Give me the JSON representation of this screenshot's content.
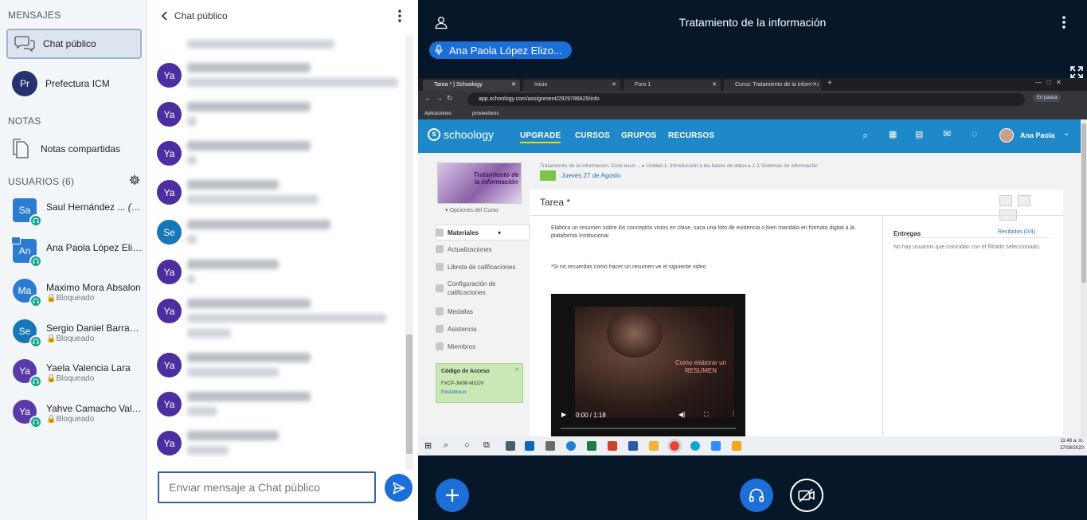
{
  "sidebar": {
    "messages_title": "MENSAJES",
    "chats": [
      {
        "label": "Chat público",
        "active": true
      },
      {
        "label": "Prefectura ICM",
        "initials": "Pr"
      }
    ],
    "notes_title": "NOTAS",
    "notes": {
      "label": "Notas compartidas"
    },
    "users_title": "USUARIOS (6)",
    "users": [
      {
        "initials": "Sa",
        "name": "Saul Hernández ...",
        "suffix": "(Tu)",
        "status": "",
        "color": "#2b7bd1",
        "shape": "square"
      },
      {
        "initials": "An",
        "name": "Ana Paola López Elizondo",
        "status": "",
        "color": "#2b7bd1",
        "shape": "square"
      },
      {
        "initials": "Ma",
        "name": "Maximo Mora Absalon",
        "status": "Bloqueado",
        "color": "#2b7bd1",
        "shape": "circle"
      },
      {
        "initials": "Se",
        "name": "Sergio Daniel Barranco López",
        "status": "Bloqueado",
        "color": "#1676b8",
        "shape": "circle"
      },
      {
        "initials": "Ya",
        "name": "Yaela Valencia Lara",
        "status": "Bloqueado",
        "color": "#5a3aa8",
        "shape": "circle"
      },
      {
        "initials": "Ya",
        "name": "Yahve Camacho Valencia",
        "status": "Bloqueado",
        "color": "#5a3aa8",
        "shape": "circle"
      }
    ]
  },
  "chat": {
    "title": "Chat público",
    "input_placeholder": "Enviar mensaje a Chat público",
    "messages": [
      {
        "initials": "Ya",
        "color": "#4b2fa0"
      },
      {
        "initials": "Ya",
        "color": "#4b2fa0"
      },
      {
        "initials": "Ya",
        "color": "#4b2fa0"
      },
      {
        "initials": "Ya",
        "color": "#4b2fa0"
      },
      {
        "initials": "Se",
        "color": "#1676b8"
      },
      {
        "initials": "Ya",
        "color": "#4b2fa0"
      },
      {
        "initials": "Ya",
        "color": "#4b2fa0"
      },
      {
        "initials": "Ya",
        "color": "#4b2fa0"
      },
      {
        "initials": "Ya",
        "color": "#4b2fa0"
      },
      {
        "initials": "Ya",
        "color": "#4b2fa0"
      }
    ]
  },
  "presentation": {
    "title": "Tratamiento de la información",
    "talker": "Ana Paola López Elizo...",
    "browser": {
      "tabs": [
        "Tarea * | Schoology",
        "Inicio",
        "Foro 1",
        "Curso: Tratamiento de la informac"
      ],
      "url": "app.schoology.com/assignment/2929786625/info",
      "paused": "En pausa",
      "bookmarks": [
        "Aplicaciones",
        "proveedores"
      ]
    },
    "schoology": {
      "logo": "schoology",
      "nav": [
        "UPGRADE",
        "CURSOS",
        "GRUPOS",
        "RECURSOS"
      ],
      "user": "Ana Paola",
      "course_image_text": "Tratamiento de la información",
      "course_options": "Opciones del Curso",
      "menu": [
        "Materiales",
        "Actualizaciones",
        "Libreta de calificaciones",
        "Configuración de calificaciones",
        "Medallas",
        "Asistencia",
        "Miembros"
      ],
      "access_code_title": "Código de Acceso",
      "access_code": "FXCP-JW98-M3JJV",
      "access_reset": "Restablecer",
      "breadcrumb": "Tratamiento de la información: Ciclo esco ... ▸ Unidad 1. Introducción a las bases de datos ▸ 1.1 Sistemas de información",
      "date": "Jueves 27 de Agosto",
      "page_title": "Tarea *",
      "description": "Elabora un resumen sobre los conceptos vistos en clase, saca una foto de evidencia o bien mandalo en formato digital a la plataforma Institucional",
      "note": "*Si no recuerdas como hacer un resumen ve el siguiente video",
      "video_overlay": "Como elaborar un RESUMEN",
      "video_time": "0:00 / 1:18",
      "submissions_title": "Entregas",
      "received": "Recibidos (0/4)",
      "no_users": "No hay usuarios que coincidan con el filtrado seleccionado."
    },
    "taskbar": {
      "time": "11:48 a. m.",
      "date": "27/08/2020"
    }
  },
  "colors": {
    "accent": "#1b6fd6",
    "mic": "#13a38f",
    "dark_bg": "#06172a",
    "schoology": "#1f88c8"
  }
}
